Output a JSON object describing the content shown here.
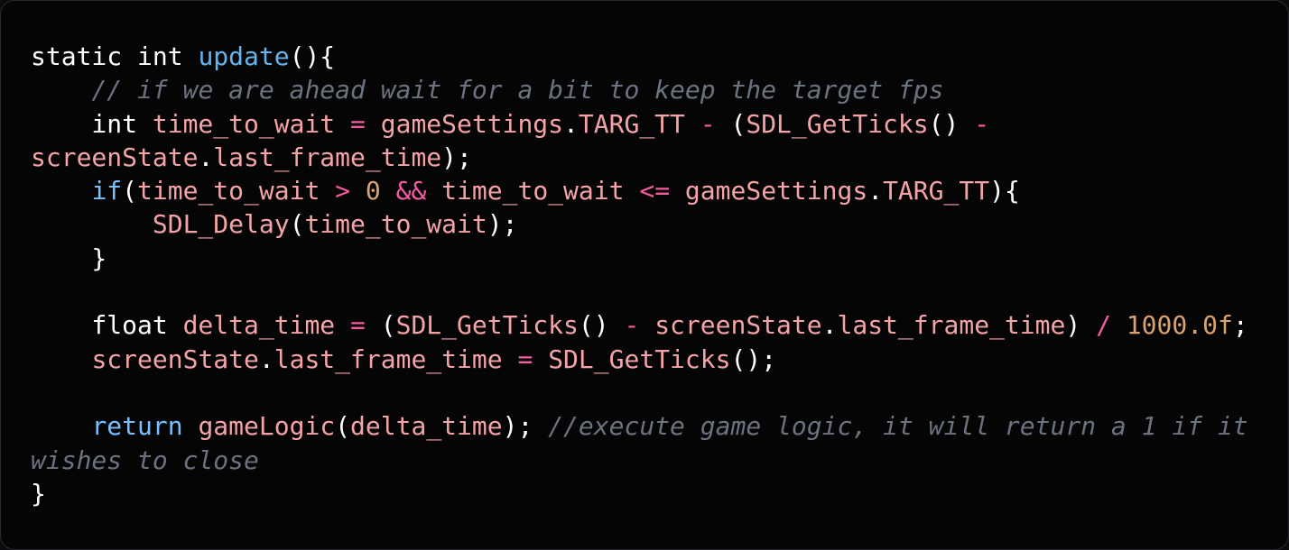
{
  "colors": {
    "background": "#050505",
    "plain": "#ffffff",
    "keyword": "#79c0ff",
    "function": "#62b5ee",
    "identifier": "#f4a3a7",
    "operator": "#f45ba0",
    "number": "#d9a26f",
    "comment": "#6b7280"
  },
  "code": {
    "lines": [
      [
        {
          "t": "static int ",
          "c": "plain"
        },
        {
          "t": "update",
          "c": "function"
        },
        {
          "t": "(){",
          "c": "plain"
        }
      ],
      [
        {
          "t": "    ",
          "c": "plain"
        },
        {
          "t": "// if we are ahead wait for a bit to keep the target fps",
          "c": "comment",
          "i": true
        }
      ],
      [
        {
          "t": "    int ",
          "c": "plain"
        },
        {
          "t": "time_to_wait",
          "c": "identifier"
        },
        {
          "t": " ",
          "c": "plain"
        },
        {
          "t": "=",
          "c": "operator"
        },
        {
          "t": " ",
          "c": "plain"
        },
        {
          "t": "gameSettings",
          "c": "identifier"
        },
        {
          "t": ".",
          "c": "plain"
        },
        {
          "t": "TARG_TT",
          "c": "identifier"
        },
        {
          "t": " ",
          "c": "plain"
        },
        {
          "t": "-",
          "c": "operator"
        },
        {
          "t": " (",
          "c": "plain"
        },
        {
          "t": "SDL_GetTicks",
          "c": "identifier"
        },
        {
          "t": "() ",
          "c": "plain"
        },
        {
          "t": "-",
          "c": "operator"
        }
      ],
      [
        {
          "t": "screenState",
          "c": "identifier"
        },
        {
          "t": ".",
          "c": "plain"
        },
        {
          "t": "last_frame_time",
          "c": "identifier"
        },
        {
          "t": ");",
          "c": "plain"
        }
      ],
      [
        {
          "t": "    ",
          "c": "plain"
        },
        {
          "t": "if",
          "c": "keyword"
        },
        {
          "t": "(",
          "c": "plain"
        },
        {
          "t": "time_to_wait",
          "c": "identifier"
        },
        {
          "t": " ",
          "c": "plain"
        },
        {
          "t": ">",
          "c": "operator"
        },
        {
          "t": " ",
          "c": "plain"
        },
        {
          "t": "0",
          "c": "number"
        },
        {
          "t": " ",
          "c": "plain"
        },
        {
          "t": "&&",
          "c": "operator"
        },
        {
          "t": " ",
          "c": "plain"
        },
        {
          "t": "time_to_wait",
          "c": "identifier"
        },
        {
          "t": " ",
          "c": "plain"
        },
        {
          "t": "<=",
          "c": "operator"
        },
        {
          "t": " ",
          "c": "plain"
        },
        {
          "t": "gameSettings",
          "c": "identifier"
        },
        {
          "t": ".",
          "c": "plain"
        },
        {
          "t": "TARG_TT",
          "c": "identifier"
        },
        {
          "t": "){",
          "c": "plain"
        }
      ],
      [
        {
          "t": "        ",
          "c": "plain"
        },
        {
          "t": "SDL_Delay",
          "c": "identifier"
        },
        {
          "t": "(",
          "c": "plain"
        },
        {
          "t": "time_to_wait",
          "c": "identifier"
        },
        {
          "t": ");",
          "c": "plain"
        }
      ],
      [
        {
          "t": "    }",
          "c": "plain"
        }
      ],
      [],
      [
        {
          "t": "    float ",
          "c": "plain"
        },
        {
          "t": "delta_time",
          "c": "identifier"
        },
        {
          "t": " ",
          "c": "plain"
        },
        {
          "t": "=",
          "c": "operator"
        },
        {
          "t": " (",
          "c": "plain"
        },
        {
          "t": "SDL_GetTicks",
          "c": "identifier"
        },
        {
          "t": "() ",
          "c": "plain"
        },
        {
          "t": "-",
          "c": "operator"
        },
        {
          "t": " ",
          "c": "plain"
        },
        {
          "t": "screenState",
          "c": "identifier"
        },
        {
          "t": ".",
          "c": "plain"
        },
        {
          "t": "last_frame_time",
          "c": "identifier"
        },
        {
          "t": ") ",
          "c": "plain"
        },
        {
          "t": "/",
          "c": "operator"
        },
        {
          "t": " ",
          "c": "plain"
        },
        {
          "t": "1000.0f",
          "c": "number"
        },
        {
          "t": ";",
          "c": "plain"
        }
      ],
      [
        {
          "t": "    ",
          "c": "plain"
        },
        {
          "t": "screenState",
          "c": "identifier"
        },
        {
          "t": ".",
          "c": "plain"
        },
        {
          "t": "last_frame_time",
          "c": "identifier"
        },
        {
          "t": " ",
          "c": "plain"
        },
        {
          "t": "=",
          "c": "operator"
        },
        {
          "t": " ",
          "c": "plain"
        },
        {
          "t": "SDL_GetTicks",
          "c": "identifier"
        },
        {
          "t": "();",
          "c": "plain"
        }
      ],
      [],
      [
        {
          "t": "    ",
          "c": "plain"
        },
        {
          "t": "return",
          "c": "keyword"
        },
        {
          "t": " ",
          "c": "plain"
        },
        {
          "t": "gameLogic",
          "c": "identifier"
        },
        {
          "t": "(",
          "c": "plain"
        },
        {
          "t": "delta_time",
          "c": "identifier"
        },
        {
          "t": "); ",
          "c": "plain"
        },
        {
          "t": "//execute game logic, it will return a 1 if it",
          "c": "comment",
          "i": true
        }
      ],
      [
        {
          "t": "wishes to close",
          "c": "comment",
          "i": true
        }
      ],
      [
        {
          "t": "}",
          "c": "plain"
        }
      ]
    ]
  }
}
